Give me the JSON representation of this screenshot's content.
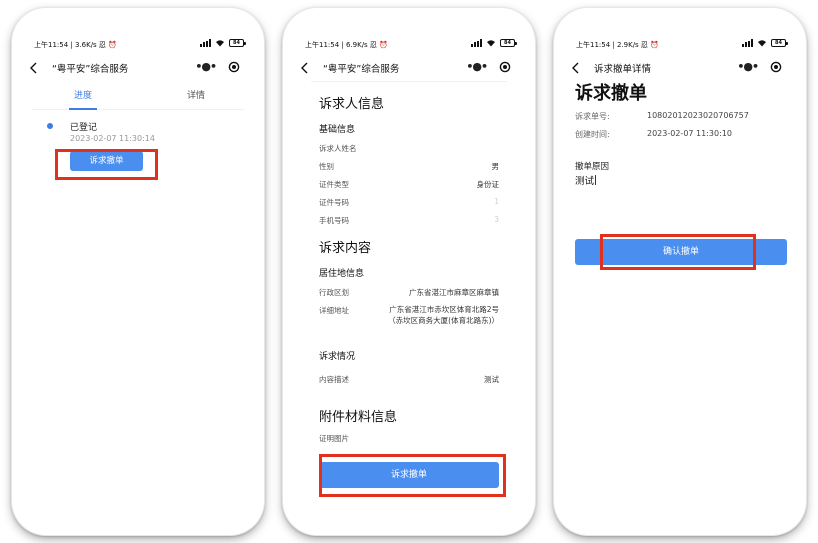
{
  "status_bar": {
    "phone1_time": "上午11:54 | 3.6K/s 忍 ⏰",
    "phone2_time": "上午11:54 | 6.9K/s 忍 ⏰",
    "phone3_time": "上午11:54 | 2.9K/s 忍 ⏰",
    "battery": "84"
  },
  "nav": {
    "service_title": "“粤平安”综合服务",
    "detail_title": "诉求撤单详情",
    "more_glyph": "•●•"
  },
  "progress_screen": {
    "tabs": [
      "进度",
      "详情"
    ],
    "event": {
      "title": "已登记",
      "time": "2023-02-07 11:30:14"
    },
    "withdraw_button": "诉求撤单"
  },
  "detail_screen": {
    "section_person": "诉求人信息",
    "sub_basic": "基础信息",
    "fields_basic": [
      {
        "label": "诉求人姓名",
        "value": ""
      },
      {
        "label": "性别",
        "value": "男"
      },
      {
        "label": "证件类型",
        "value": "身份证"
      },
      {
        "label": "证件号码",
        "value": "1"
      },
      {
        "label": "手机号码",
        "value": "3"
      }
    ],
    "section_content": "诉求内容",
    "sub_residence": "居住地信息",
    "fields_residence": [
      {
        "label": "行政区划",
        "value": "广东省湛江市麻章区麻章镇"
      },
      {
        "label": "详细地址",
        "value": "广东省湛江市赤坎区体育北路2号（赤坎区商务大厦(体育北路东)）"
      }
    ],
    "sub_situation": "诉求情况",
    "fields_situation": [
      {
        "label": "内容描述",
        "value": "测试"
      }
    ],
    "section_attach": "附件材料信息",
    "attach_label": "证明图片",
    "withdraw_button": "诉求撤单"
  },
  "withdraw_screen": {
    "title": "诉求撤单",
    "order_label": "诉求单号:",
    "order_value": "10802012023020706757",
    "created_label": "创建时间:",
    "created_value": "2023-02-07 11:30:10",
    "reason_label": "撤单原因",
    "reason_value": "测试",
    "confirm_button": "确认撤单"
  },
  "colors": {
    "accent": "#4a8ef0",
    "highlight": "#e0301e"
  }
}
